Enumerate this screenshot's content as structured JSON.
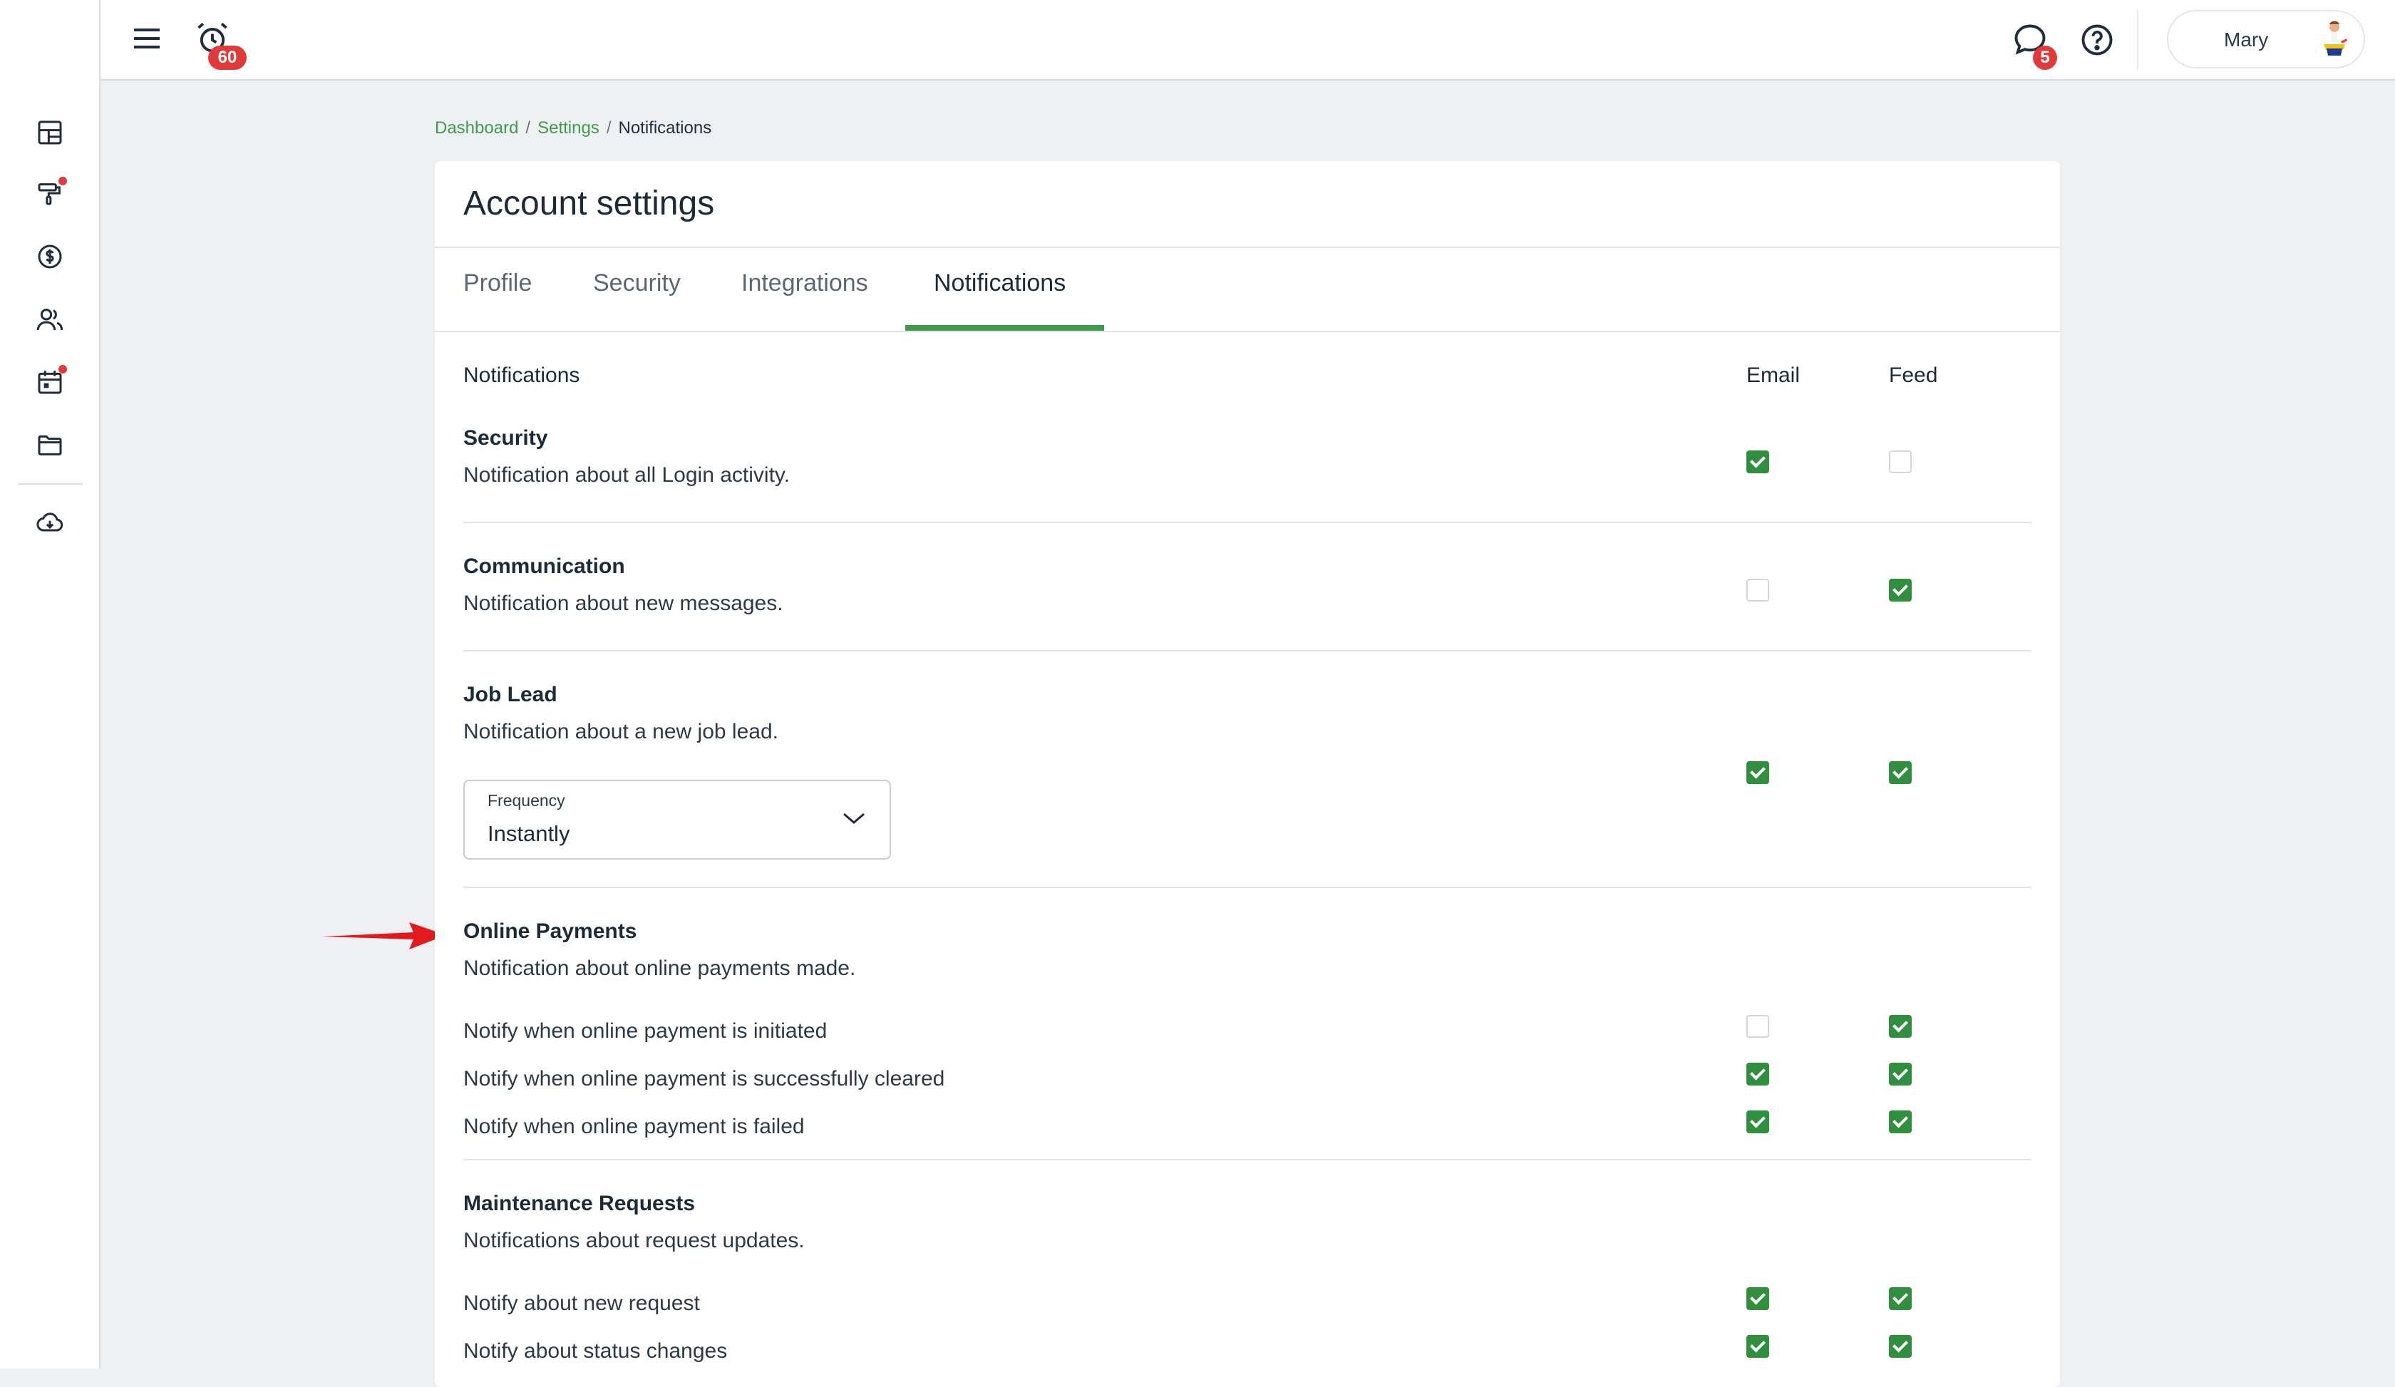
{
  "topbar": {
    "alarm_badge": "60",
    "chat_badge": "5",
    "user_name": "Mary"
  },
  "sidebar": {
    "items": [
      {
        "icon": "dashboard-grid-icon",
        "dot": false
      },
      {
        "icon": "paint-roller-icon",
        "dot": true
      },
      {
        "icon": "dollar-circle-icon",
        "dot": false
      },
      {
        "icon": "users-icon",
        "dot": false
      },
      {
        "icon": "calendar-icon",
        "dot": true
      },
      {
        "icon": "folder-icon",
        "dot": false
      },
      {
        "icon": "cloud-download-icon",
        "dot": false
      }
    ]
  },
  "breadcrumb": {
    "items": [
      "Dashboard",
      "Settings",
      "Notifications"
    ],
    "separator": "/"
  },
  "page": {
    "title": "Account settings",
    "tabs": [
      "Profile",
      "Security",
      "Integrations",
      "Notifications"
    ],
    "active_tab": "Notifications"
  },
  "table": {
    "col_notifications": "Notifications",
    "col_email": "Email",
    "col_feed": "Feed"
  },
  "sections": {
    "security": {
      "title": "Security",
      "desc": "Notification about all Login activity.",
      "email": true,
      "feed": false
    },
    "communication": {
      "title": "Communication",
      "desc": "Notification about new messages.",
      "email": false,
      "feed": true
    },
    "job_lead": {
      "title": "Job Lead",
      "desc": "Notification about a new job lead.",
      "email": true,
      "feed": true,
      "frequency_label": "Frequency",
      "frequency_value": "Instantly"
    },
    "online_payments": {
      "title": "Online Payments",
      "desc": "Notification about online payments made.",
      "rows": [
        {
          "label": "Notify when online payment is initiated",
          "email": false,
          "feed": true
        },
        {
          "label": "Notify when online payment is successfully cleared",
          "email": true,
          "feed": true
        },
        {
          "label": "Notify when online payment is failed",
          "email": true,
          "feed": true
        }
      ]
    },
    "maintenance": {
      "title": "Maintenance Requests",
      "desc": "Notifications about request updates.",
      "rows": [
        {
          "label": "Notify about new request",
          "email": true,
          "feed": true
        },
        {
          "label": "Notify about status changes",
          "email": true,
          "feed": true
        }
      ]
    }
  },
  "colors": {
    "accent_green": "#3f9b4b",
    "checkbox_green": "#2f8f3e",
    "badge_red": "#e03a3a",
    "annotation_arrow": "#e11b1b"
  }
}
